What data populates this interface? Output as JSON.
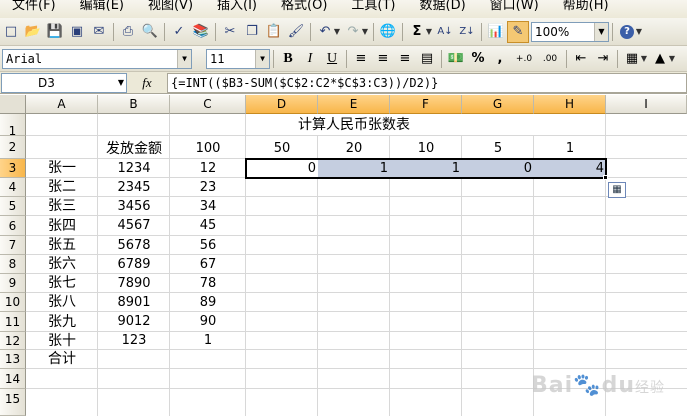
{
  "menu": [
    "文件(F)",
    "编辑(E)",
    "视图(V)",
    "插入(I)",
    "格式(O)",
    "工具(T)",
    "数据(D)",
    "窗口(W)",
    "帮助(H)"
  ],
  "toolbar": {
    "zoom": "100%",
    "font_name": "Arial",
    "font_size": "11",
    "bold": "B",
    "italic": "I",
    "underline": "U",
    "sigma": "Σ",
    "percent": "%",
    "comma": ",",
    "inc_decimal": "+.0",
    "dec_decimal": ".00"
  },
  "formula_bar": {
    "name_box": "D3",
    "fx": "fx",
    "formula": "{=INT(($B3-SUM($C$2:C2*$C$3:C3))/D2)}"
  },
  "columns": [
    "A",
    "B",
    "C",
    "D",
    "E",
    "F",
    "G",
    "H",
    "I"
  ],
  "rows": [
    "1",
    "2",
    "3",
    "4",
    "5",
    "6",
    "7",
    "8",
    "9",
    "10",
    "11",
    "12",
    "13",
    "14",
    "15"
  ],
  "sheet": {
    "title": "计算人民币张数表",
    "b2": "发放金额",
    "c2": "100",
    "d2": "50",
    "e2": "20",
    "f2": "10",
    "g2": "5",
    "h2": "1",
    "names": [
      "张一",
      "张二",
      "张三",
      "张四",
      "张五",
      "张六",
      "张七",
      "张八",
      "张九",
      "张十"
    ],
    "amounts": [
      "1234",
      "2345",
      "3456",
      "4567",
      "5678",
      "6789",
      "7890",
      "8901",
      "9012",
      "123"
    ],
    "hundreds": [
      "12",
      "23",
      "34",
      "45",
      "56",
      "67",
      "78",
      "89",
      "90",
      "1"
    ],
    "row3_results": [
      "0",
      "1",
      "1",
      "0",
      "4"
    ],
    "total_label": "合计"
  },
  "watermark": {
    "brand": "Bai",
    "paw": "du",
    "suffix": "经验"
  }
}
